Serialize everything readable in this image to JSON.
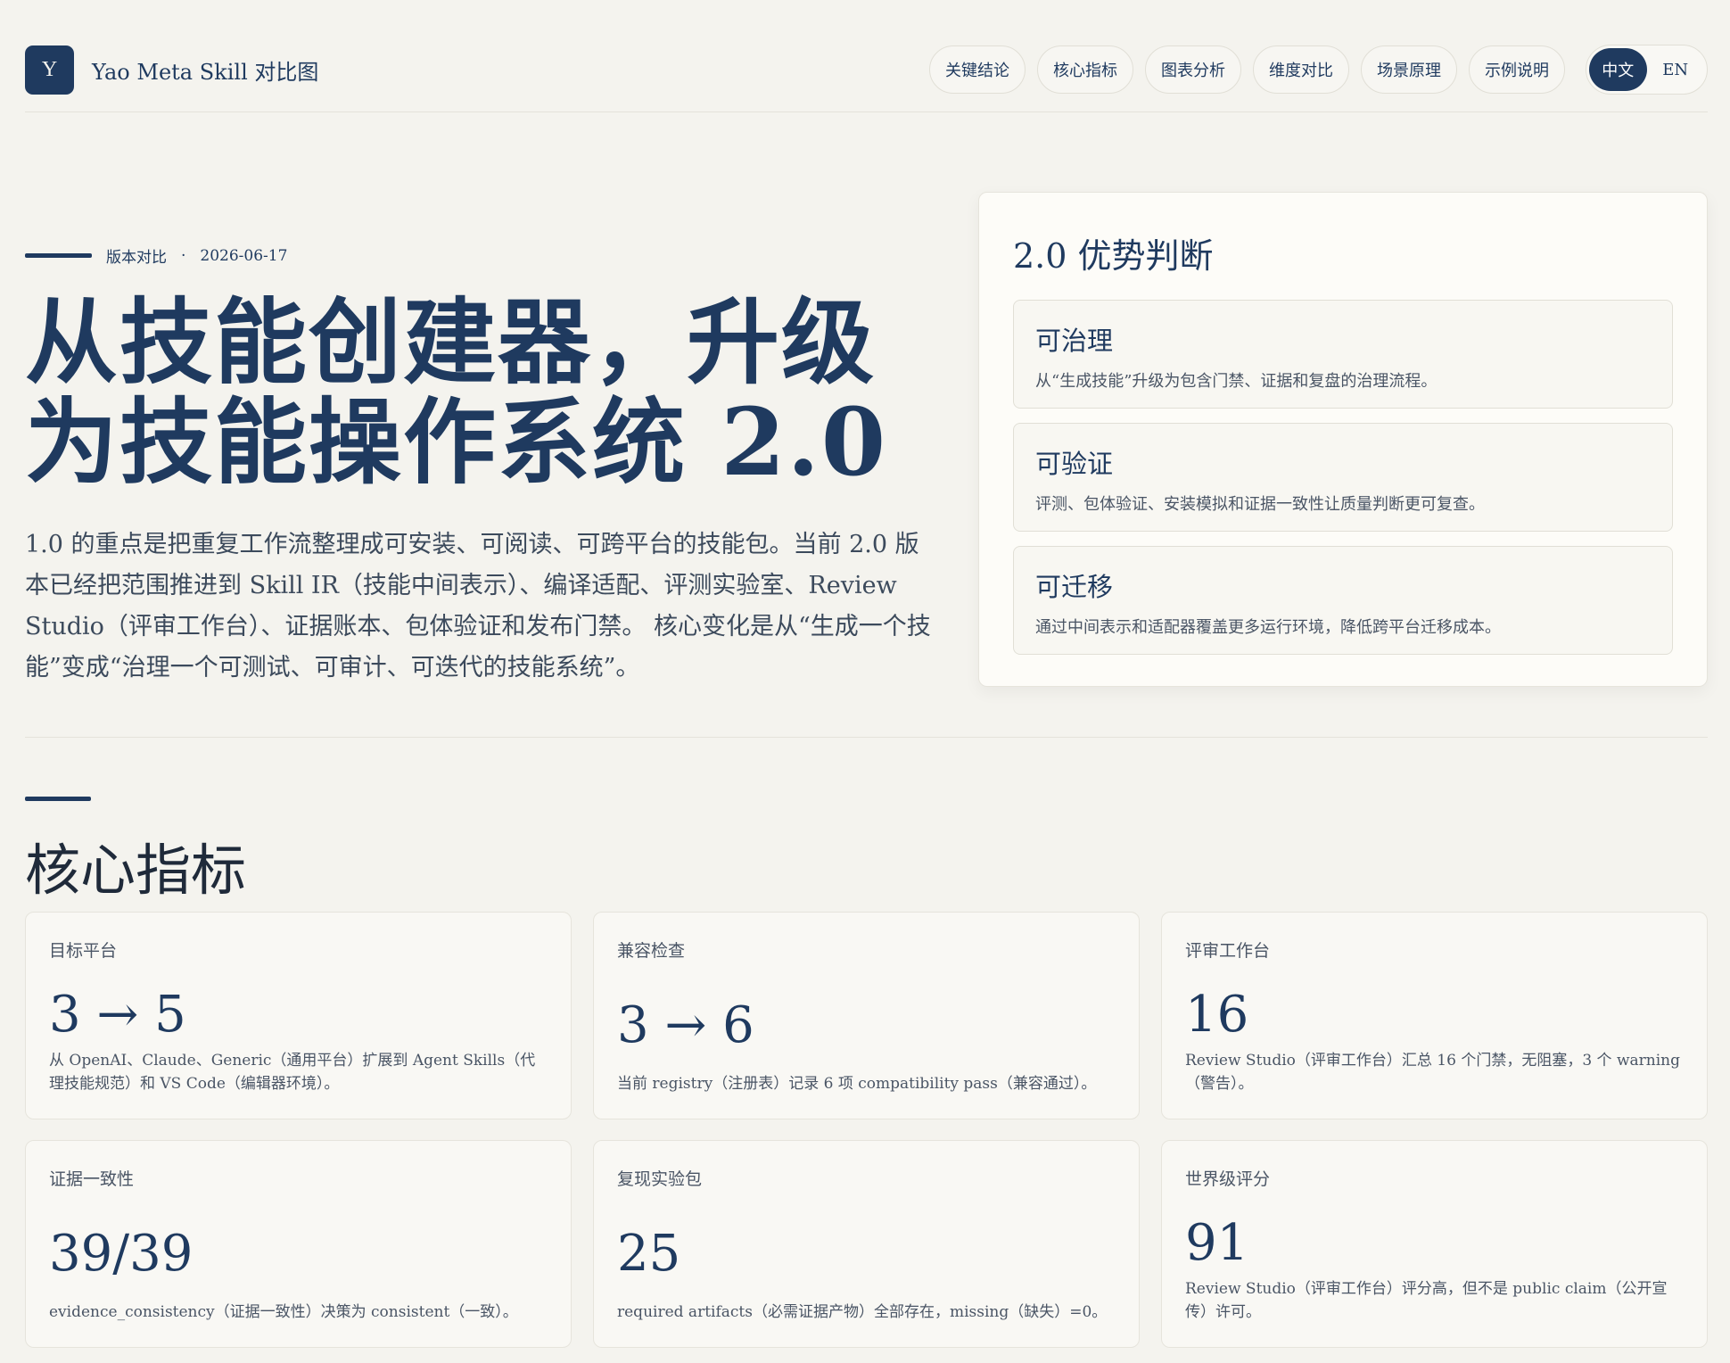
{
  "header": {
    "logo_letter": "Y",
    "title": "Yao Meta Skill 对比图",
    "nav": [
      "关键结论",
      "核心指标",
      "图表分析",
      "维度对比",
      "场景原理",
      "示例说明"
    ],
    "lang": {
      "zh": "中文",
      "en": "EN",
      "active": "zh"
    }
  },
  "hero": {
    "eyebrow": "版本对比",
    "sep": "·",
    "date": "2026-06-17",
    "title_line1": "从技能创建器，升级",
    "title_line2": "为技能操作系统 2.0",
    "description": "1.0 的重点是把重复工作流整理成可安装、可阅读、可跨平台的技能包。当前 2.0 版本已经把范围推进到 Skill IR（技能中间表示）、编译适配、评测实验室、Review Studio（评审工作台）、证据账本、包体验证和发布门禁。 核心变化是从“生成一个技能”变成“治理一个可测试、可审计、可迭代的技能系统”。"
  },
  "advantages": {
    "title": "2.0 优势判断",
    "items": [
      {
        "title": "可治理",
        "desc": "从“生成技能”升级为包含门禁、证据和复盘的治理流程。"
      },
      {
        "title": "可验证",
        "desc": "评测、包体验证、安装模拟和证据一致性让质量判断更可复查。"
      },
      {
        "title": "可迁移",
        "desc": "通过中间表示和适配器覆盖更多运行环境，降低跨平台迁移成本。"
      }
    ]
  },
  "metrics": {
    "title": "核心指标",
    "cards": [
      {
        "label": "目标平台",
        "value": "3 → 5",
        "note": "从 OpenAI、Claude、Generic（通用平台）扩展到 Agent Skills（代理技能规范）和 VS Code（编辑器环境）。"
      },
      {
        "label": "兼容检查",
        "value": "3 → 6",
        "note": "当前 registry（注册表）记录 6 项 compatibility pass（兼容通过）。"
      },
      {
        "label": "评审工作台",
        "value": "16",
        "note": "Review Studio（评审工作台）汇总 16 个门禁，无阻塞，3 个 warning（警告）。"
      },
      {
        "label": "证据一致性",
        "value": "39/39",
        "note": "evidence_consistency（证据一致性）决策为 consistent（一致）。"
      },
      {
        "label": "复现实验包",
        "value": "25",
        "note": "required artifacts（必需证据产物）全部存在，missing（缺失）=0。"
      },
      {
        "label": "世界级评分",
        "value": "91",
        "note": "Review Studio（评审工作台）评分高，但不是 public claim（公开宣传）许可。"
      }
    ]
  }
}
